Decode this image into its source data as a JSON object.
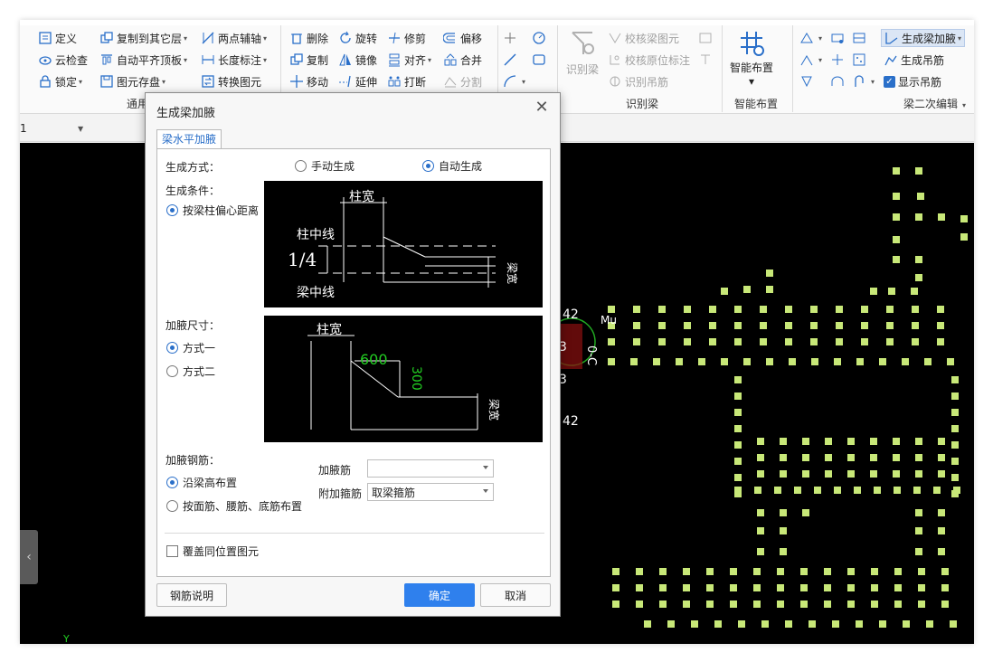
{
  "ribbon": {
    "group1": {
      "label": "通用",
      "items": [
        "定义",
        "复制到其它层",
        "两点辅轴",
        "云检查",
        "自动平齐顶板",
        "长度标注",
        "锁定",
        "图元存盘",
        "转换图元"
      ]
    },
    "group2": {
      "items": [
        "删除",
        "旋转",
        "修剪",
        "偏移",
        "复制",
        "镜像",
        "对齐",
        "合并",
        "移动",
        "延伸",
        "打断",
        "分割"
      ]
    },
    "group3": {
      "label": "识别梁",
      "big_button": "识别梁",
      "items": [
        "校核梁图元",
        "校核原位标注",
        "识别吊筋"
      ]
    },
    "group4": {
      "label": "智能布置",
      "big_button": "智能布置"
    },
    "group5": {
      "label": "梁二次编辑",
      "items": [
        "生成梁加腋",
        "生成吊筋",
        "显示吊筋"
      ]
    }
  },
  "subbar": {
    "layer_value": "1"
  },
  "canvas": {
    "labels": [
      "42",
      "0-C",
      "Mu",
      "3",
      "42",
      "3"
    ],
    "axis_mark": "Y"
  },
  "colors": {
    "canvas_bg": "#000000",
    "column_fill": "#c8e878",
    "primary_button": "#2f80ed",
    "accent_text": "#2a6fc9",
    "diagram_green": "#22cc22"
  },
  "dialog": {
    "title": "生成梁加腋",
    "tab": "梁水平加腋",
    "gen_mode": {
      "label": "生成方式：",
      "manual": "手动生成",
      "auto": "自动生成",
      "selected": "auto"
    },
    "gen_cond": {
      "label": "生成条件：",
      "option": "按梁柱偏心距离"
    },
    "diagram1": {
      "col_width": "柱宽",
      "col_center": "柱中线",
      "ratio": "1/4",
      "beam_center": "梁中线",
      "beam_width": "梁宽"
    },
    "haunch_size": {
      "label": "加腋尺寸：",
      "opt1": "方式一",
      "opt2": "方式二",
      "selected": "opt1"
    },
    "diagram2": {
      "col_width": "柱宽",
      "dim_h": "600",
      "dim_v": "300",
      "beam_width": "梁宽"
    },
    "rebar": {
      "label": "加腋钢筋：",
      "opt1": "沿梁高布置",
      "opt2": "按面筋、腰筋、底筋布置",
      "selected": "opt1"
    },
    "haunch_bar": {
      "label": "加腋筋",
      "value": ""
    },
    "extra_stirrup": {
      "label": "附加箍筋",
      "value": "取梁箍筋"
    },
    "overwrite": {
      "label": "覆盖同位置图元",
      "checked": false
    },
    "buttons": {
      "help": "钢筋说明",
      "ok": "确定",
      "cancel": "取消"
    }
  }
}
